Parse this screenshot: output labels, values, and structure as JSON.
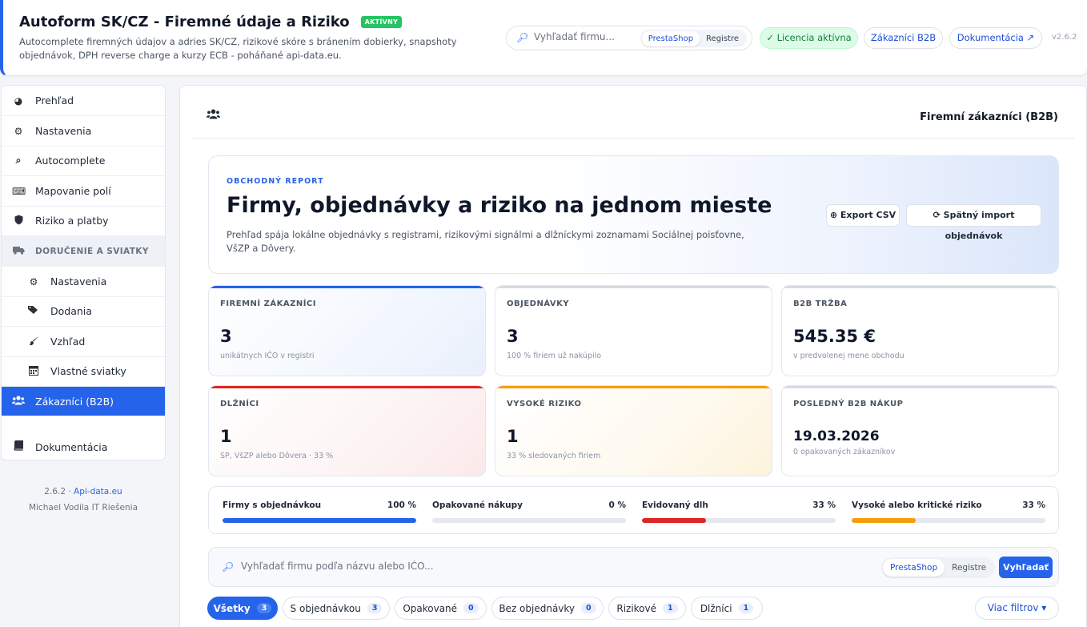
{
  "header": {
    "title": "Autoform SK/CZ - Firemné údaje a Riziko",
    "badge": "AKTÍVNY",
    "description": "Autocomplete firemných údajov a adries SK/CZ, rizikové skóre s bránením dobierky, snapshoty objednávok, DPH reverse charge a kurzy ECB - poháňané api-data.eu.",
    "search": {
      "placeholder": "Vyhľadať firmu...",
      "icon": "search-icon",
      "sources": [
        "PrestaShop",
        "Registre"
      ],
      "active_source": "PrestaShop"
    },
    "license": "✓ Licencia aktívna",
    "b2b_button": "Zákazníci B2B",
    "docs_button": "Dokumentácia ↗",
    "version": "v2.6.2"
  },
  "sidebar": {
    "items": [
      {
        "label": "Prehľad",
        "icon": "dashboard-icon"
      },
      {
        "label": "Nastavenia",
        "icon": "cogs-icon"
      },
      {
        "label": "Autocomplete",
        "icon": "search-icon"
      },
      {
        "label": "Mapovanie polí",
        "icon": "keyboard-icon"
      },
      {
        "label": "Riziko a platby",
        "icon": "shield-icon"
      },
      {
        "label": "DORUČENIE A SVIATKY",
        "icon": "truck-icon",
        "group": true
      },
      {
        "label": "Nastavenia",
        "icon": "gear-icon",
        "sub": true
      },
      {
        "label": "Dodania",
        "icon": "tags-icon",
        "sub": true
      },
      {
        "label": "Vzhľad",
        "icon": "brush-icon",
        "sub": true
      },
      {
        "label": "Vlastné sviatky",
        "icon": "calendar-icon",
        "sub": true
      },
      {
        "label": "Zákazníci (B2B)",
        "icon": "users-icon",
        "active": true
      },
      {
        "label": "Dokumentácia",
        "icon": "book-icon"
      }
    ],
    "footer_version": "2.6.2 · ",
    "footer_link": "Api-data.eu",
    "footer_author": "Michael Vodila IT Riešenia"
  },
  "main": {
    "title": "Firemní zákazníci (B2B)",
    "hero": {
      "kicker": "OBCHODNÝ REPORT",
      "title": "Firmy, objednávky a riziko na jednom mieste",
      "description": "Prehľad spája lokálne objednávky s registrami, rizikovými signálmi a dlžníckymi zoznamami Sociálnej poisťovne, VšZP a Dôvery.",
      "export_button": "⊕ Export CSV",
      "import_button": "⟳ Spätný import objednávok"
    },
    "stats": [
      {
        "label": "FIREMNÍ ZÁKAZNÍCI",
        "value": "3",
        "sub": "unikátnych IČO v registri",
        "accent": "#2563eb"
      },
      {
        "label": "OBJEDNÁVKY",
        "value": "3",
        "sub": "100 % firiem už nakúpilo",
        "accent": "#d6dbe4"
      },
      {
        "label": "B2B TRŽBA",
        "value": "545.35 €",
        "sub": "v predvolenej mene obchodu",
        "accent": "#d6dbe4"
      },
      {
        "label": "DLŽNÍCI",
        "value": "1",
        "sub": "SP, VšZP alebo Dôvera · 33 %",
        "accent": "#dc2626"
      },
      {
        "label": "VYSOKÉ RIZIKO",
        "value": "1",
        "sub": "33 % sledovaných firiem",
        "accent": "#f59e0b"
      },
      {
        "label": "POSLEDNÝ B2B NÁKUP",
        "value": "19.03.2026",
        "sub": "0 opakovaných zákazníkov",
        "accent": "#d6dbe4"
      }
    ],
    "progress": [
      {
        "label": "Firmy s objednávkou",
        "value_text": "100 %",
        "value": 100,
        "color": "#2563eb"
      },
      {
        "label": "Opakované nákupy",
        "value_text": "0 %",
        "value": 0,
        "color": "#2563eb"
      },
      {
        "label": "Evidovaný dlh",
        "value_text": "33 %",
        "value": 33,
        "color": "#dc2626"
      },
      {
        "label": "Vysoké alebo kritické riziko",
        "value_text": "33 %",
        "value": 33,
        "color": "#f59e0b"
      }
    ],
    "search": {
      "placeholder": "Vyhľadať firmu podľa názvu alebo IČO...",
      "sources": [
        "PrestaShop",
        "Registre"
      ],
      "active_source": "PrestaShop",
      "button": "Vyhľadať"
    },
    "filters": [
      {
        "label": "Všetky",
        "count": "3",
        "active": true
      },
      {
        "label": "S objednávkou",
        "count": "3"
      },
      {
        "label": "Opakované",
        "count": "0"
      },
      {
        "label": "Bez objednávky",
        "count": "0"
      },
      {
        "label": "Rizikové",
        "count": "1"
      },
      {
        "label": "Dlžníci",
        "count": "1"
      }
    ],
    "more_filters": "Viac filtrov ▾"
  },
  "colors": {
    "accent": "#2563eb",
    "success": "#22c55e",
    "danger": "#dc2626",
    "warning": "#f59e0b"
  }
}
